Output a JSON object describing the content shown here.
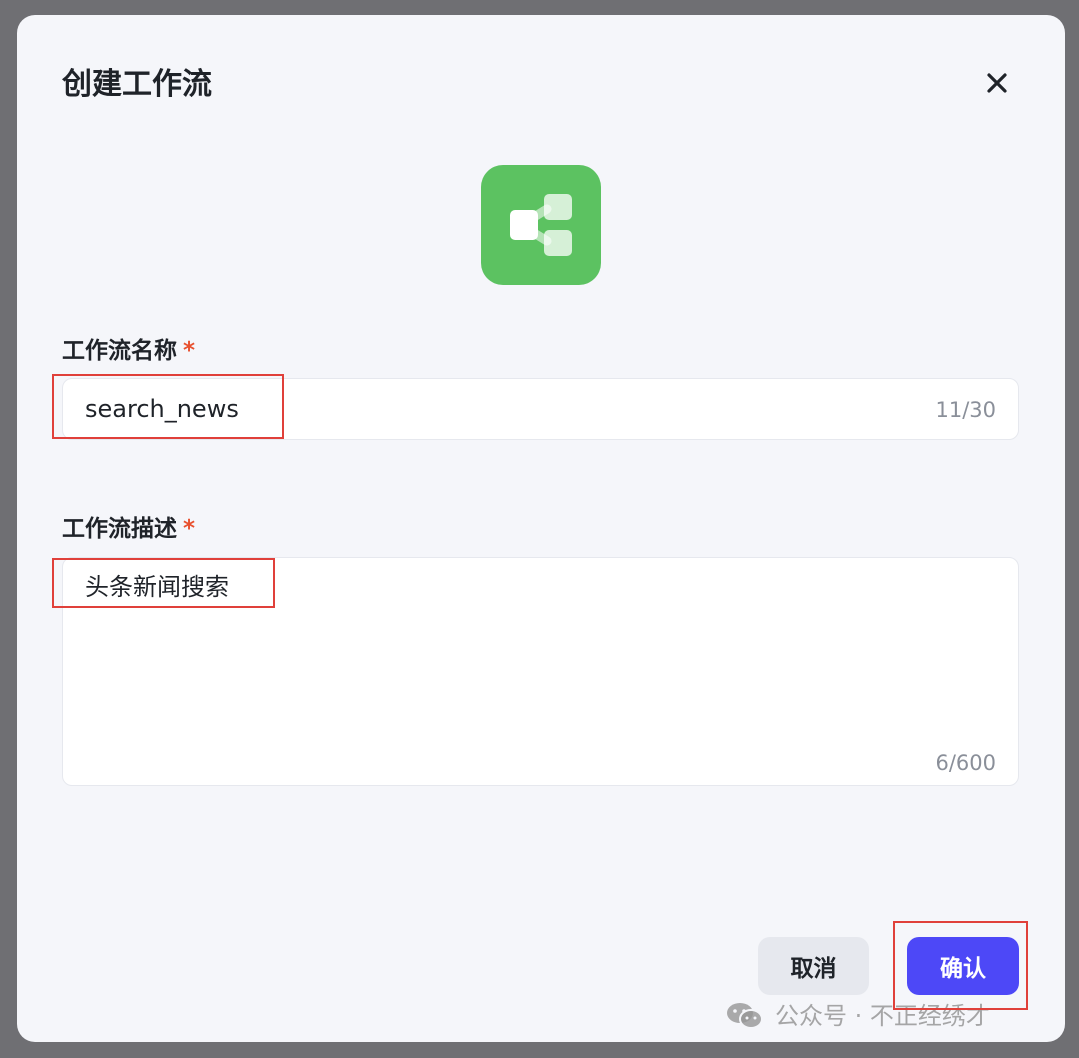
{
  "dialog": {
    "title": "创建工作流",
    "close_icon": "close-icon",
    "app_icon": "workflow-icon",
    "app_icon_color": "#5cc261"
  },
  "form": {
    "name": {
      "label": "工作流名称",
      "required_mark": "*",
      "value": "search_news",
      "counter": "11/30"
    },
    "description": {
      "label": "工作流描述",
      "required_mark": "*",
      "value": "头条新闻搜索",
      "counter": "6/600"
    }
  },
  "buttons": {
    "cancel_label": "取消",
    "confirm_label": "确认",
    "confirm_color": "#4d48f7"
  },
  "watermark": {
    "icon": "wechat-icon",
    "text": "公众号 · 不正经绣才"
  },
  "colors": {
    "required": "#e8502e",
    "highlight": "#e0403a"
  }
}
